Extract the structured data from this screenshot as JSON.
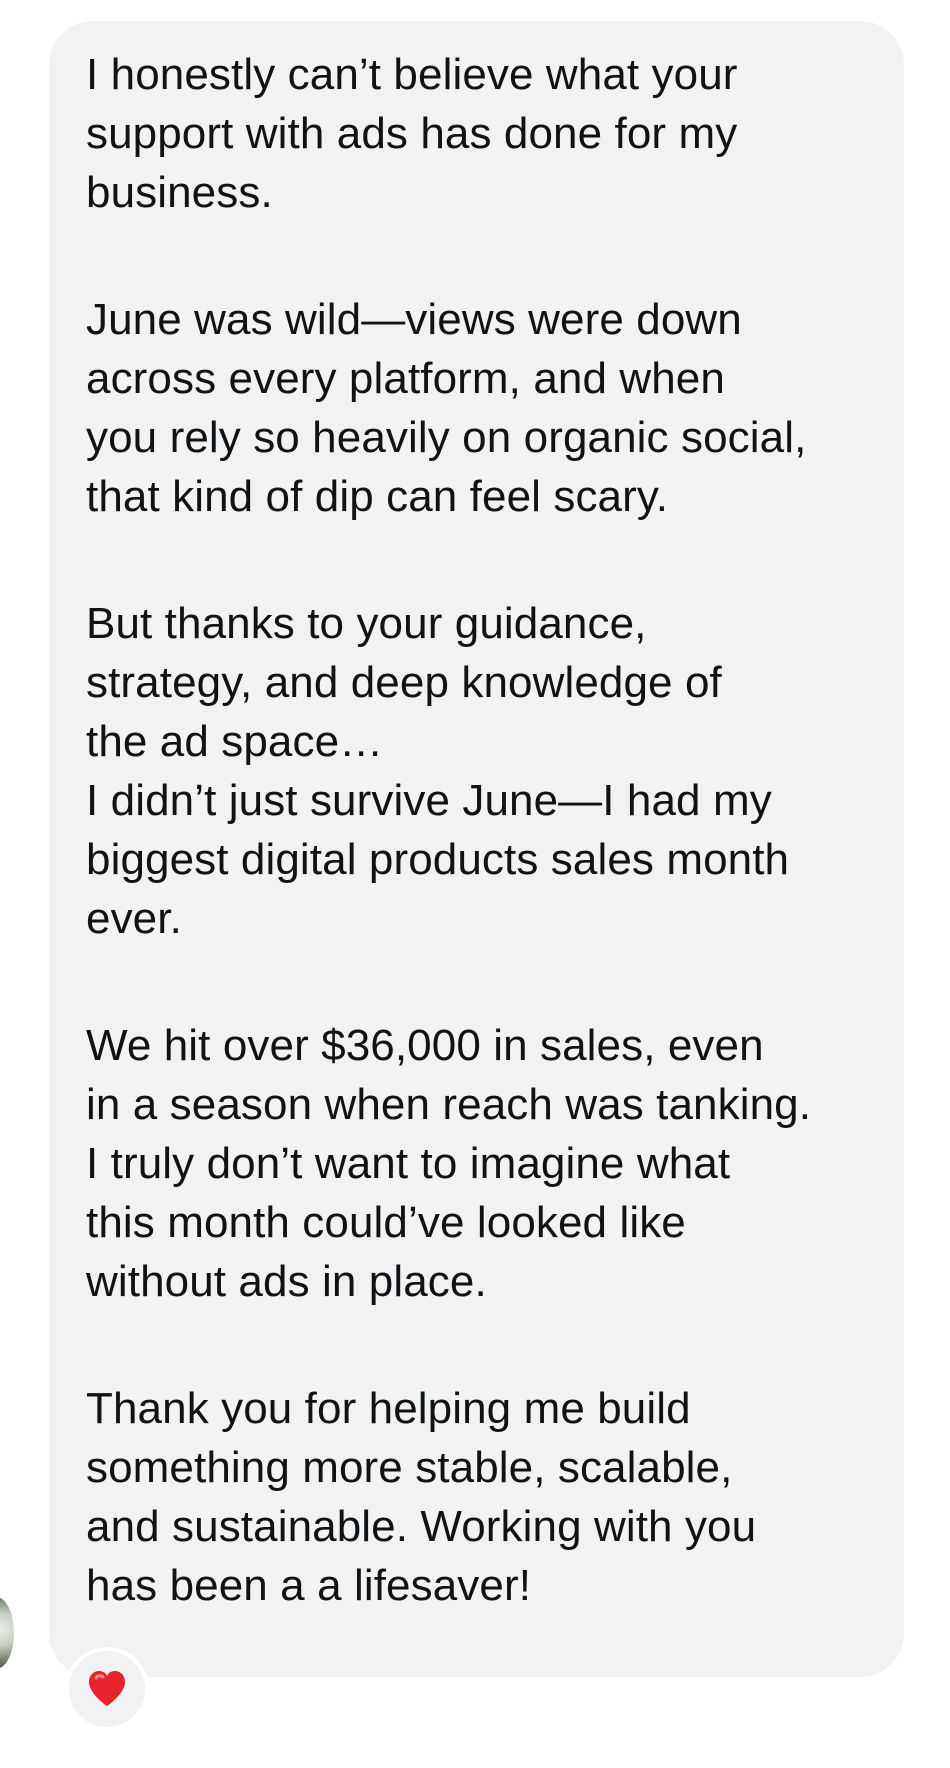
{
  "message": {
    "paragraphs": [
      "I honestly can’t believe what your\nsupport with ads has done for my\nbusiness.",
      "June was wild—views were down\nacross every platform, and when\nyou rely so heavily on organic social,\nthat kind of dip can feel scary.",
      "But thanks to your guidance,\nstrategy, and deep knowledge of\nthe ad space…",
      "I didn’t just survive June—I had my\nbiggest digital products sales month\never.",
      "We hit over $36,000 in sales, even\nin a season when reach was tanking.",
      "I truly don’t want to imagine what\nthis month could’ve looked like\nwithout ads in place.",
      "Thank you for helping me build\nsomething more stable, scalable,\nand sustainable. Working with you\nhas been a a lifesaver!"
    ]
  },
  "reaction": {
    "icon": "red-heart-icon",
    "color": "#e8242b"
  },
  "colors": {
    "bubble": "#f1f2f4",
    "text": "#121212",
    "background": "#ffffff"
  }
}
